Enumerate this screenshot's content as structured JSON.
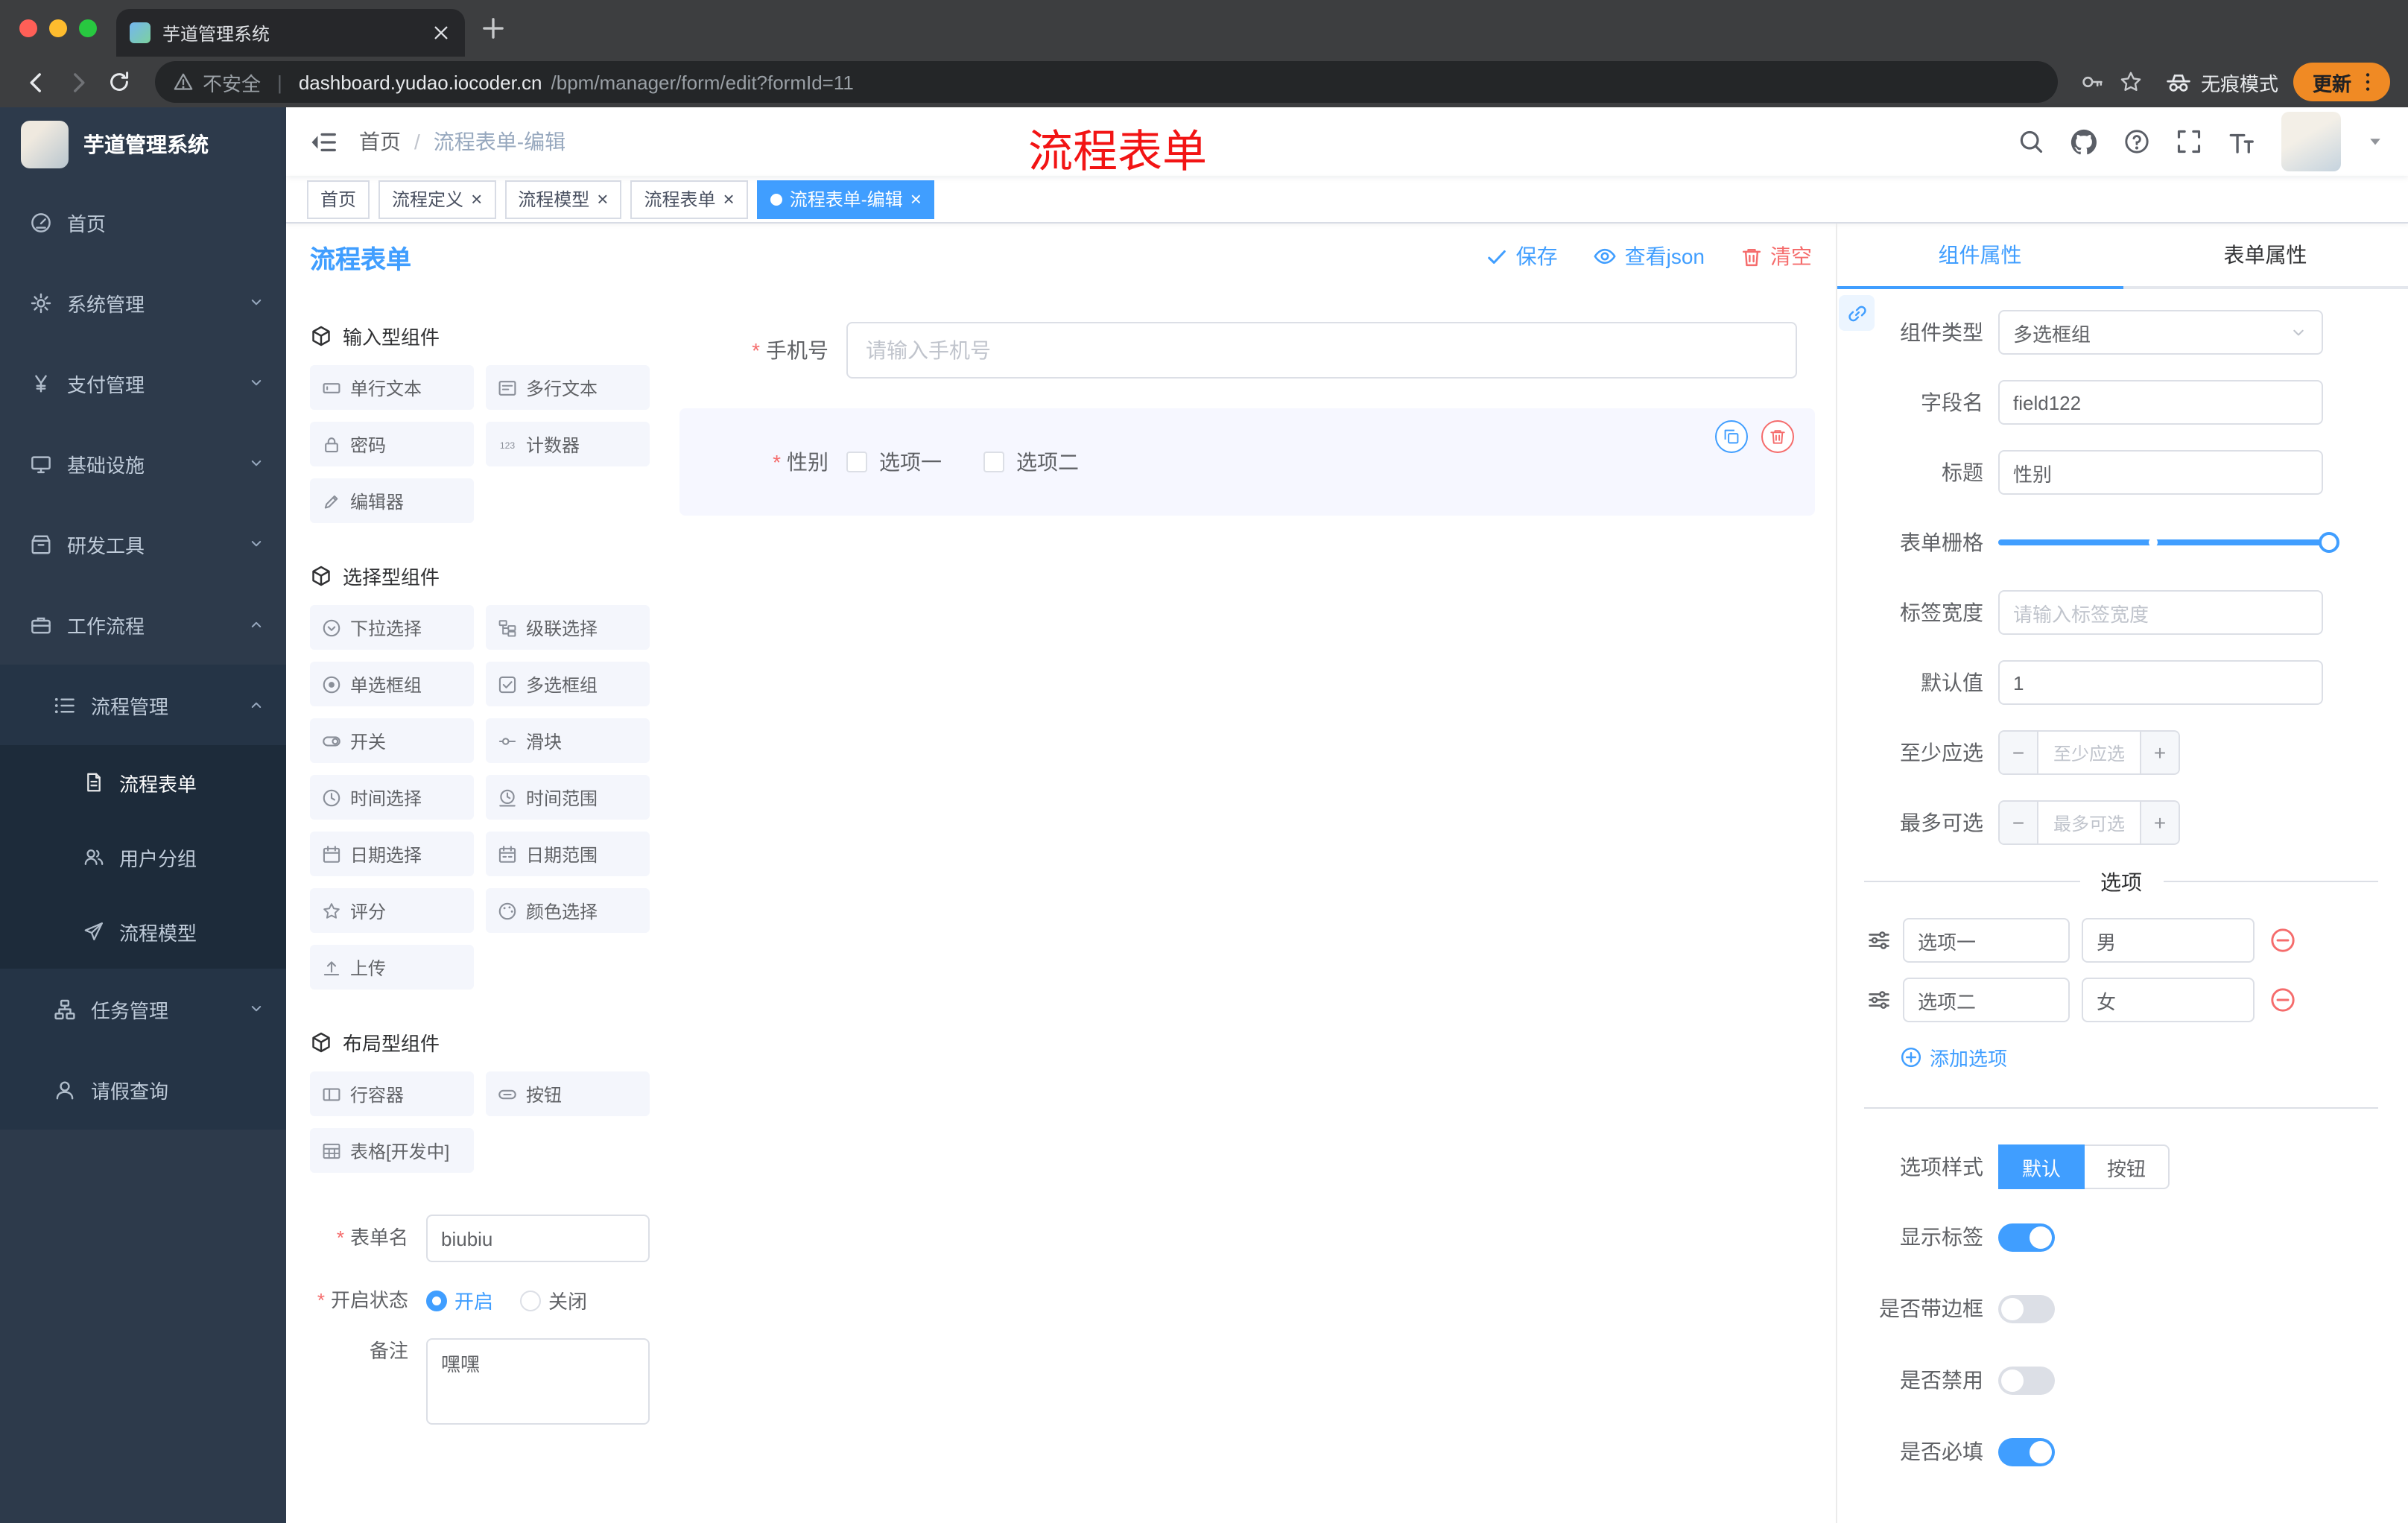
{
  "browser": {
    "tab_title": "芋道管理系统",
    "url_security": "不安全",
    "url_divider": "|",
    "url_domain": "dashboard.yudao.iocoder.cn",
    "url_path": "/bpm/manager/form/edit?formId=11",
    "incognito_label": "无痕模式",
    "update_label": "更新"
  },
  "sidebar": {
    "logo_title": "芋道管理系统",
    "top_items": [
      {
        "label": "首页",
        "icon": "#i-gauge",
        "is_down": false,
        "is_up": false,
        "active": false
      },
      {
        "label": "系统管理",
        "icon": "#i-gear",
        "is_down": true,
        "is_up": false,
        "active": false
      },
      {
        "label": "支付管理",
        "icon": "#i-yen",
        "is_down": true,
        "is_up": false,
        "active": false
      },
      {
        "label": "基础设施",
        "icon": "#i-monitor",
        "is_down": true,
        "is_up": false,
        "active": false
      },
      {
        "label": "研发工具",
        "icon": "#i-box",
        "is_down": true,
        "is_up": false,
        "active": false
      },
      {
        "label": "工作流程",
        "icon": "#i-case",
        "is_down": false,
        "is_up": true,
        "active": false
      }
    ],
    "process_mgmt": {
      "label": "流程管理"
    },
    "process_children": [
      {
        "label": "流程表单",
        "icon": "#i-doc",
        "active": true
      },
      {
        "label": "用户分组",
        "icon": "#i-users",
        "active": false
      },
      {
        "label": "流程模型",
        "icon": "#i-send",
        "active": false
      }
    ],
    "task_mgmt": {
      "label": "任务管理"
    },
    "leave_query": {
      "label": "请假查询"
    }
  },
  "header": {
    "breadcrumb_home": "首页",
    "breadcrumb_sep": "/",
    "breadcrumb_current": "流程表单-编辑",
    "annotation": "流程表单",
    "icons": [
      "search-icon",
      "github-icon",
      "question-icon",
      "fullscreen-icon",
      "font-size-icon",
      "avatar",
      "caret-down-icon"
    ]
  },
  "tags": [
    {
      "label": "首页",
      "closable": false,
      "active": false
    },
    {
      "label": "流程定义",
      "closable": true,
      "active": false
    },
    {
      "label": "流程模型",
      "closable": true,
      "active": false
    },
    {
      "label": "流程表单",
      "closable": true,
      "active": false
    },
    {
      "label": "流程表单-编辑",
      "closable": true,
      "active": true
    }
  ],
  "designer": {
    "title": "流程表单",
    "actions": {
      "save": "保存",
      "view_json": "查看json",
      "clear": "清空"
    },
    "sections": {
      "input_title": "输入型组件",
      "select_title": "选择型组件",
      "layout_title": "布局型组件"
    },
    "input_widgets": [
      {
        "label": "单行文本",
        "icon": "#i-inputbox"
      },
      {
        "label": "多行文本",
        "icon": "#i-textarea"
      },
      {
        "label": "密码",
        "icon": "#i-lock"
      },
      {
        "label": "计数器",
        "icon": "#i-counter"
      },
      {
        "label": "编辑器",
        "icon": "#i-edit"
      }
    ],
    "select_widgets": [
      {
        "label": "下拉选择",
        "icon": "#i-select"
      },
      {
        "label": "级联选择",
        "icon": "#i-cascade"
      },
      {
        "label": "单选框组",
        "icon": "#i-radio"
      },
      {
        "label": "多选框组",
        "icon": "#i-checkbox"
      },
      {
        "label": "开关",
        "icon": "#i-switch"
      },
      {
        "label": "滑块",
        "icon": "#i-slider"
      },
      {
        "label": "时间选择",
        "icon": "#i-time"
      },
      {
        "label": "时间范围",
        "icon": "#i-timerange"
      },
      {
        "label": "日期选择",
        "icon": "#i-date"
      },
      {
        "label": "日期范围",
        "icon": "#i-daterange"
      },
      {
        "label": "评分",
        "icon": "#i-star"
      },
      {
        "label": "颜色选择",
        "icon": "#i-color"
      },
      {
        "label": "上传",
        "icon": "#i-upload"
      }
    ],
    "layout_widgets": [
      {
        "label": "行容器",
        "icon": "#i-rowc"
      },
      {
        "label": "按钮",
        "icon": "#i-btnc"
      },
      {
        "label": "表格[开发中]",
        "icon": "#i-tablec"
      }
    ],
    "form_config": {
      "name_label": "表单名",
      "name_value": "biubiu",
      "status_label": "开启状态",
      "status_on": "开启",
      "status_off": "关闭",
      "remark_label": "备注",
      "remark_value": "嘿嘿"
    }
  },
  "canvas": {
    "phone": {
      "label": "手机号",
      "placeholder": "请输入手机号"
    },
    "gender": {
      "label": "性别",
      "options": [
        "选项一",
        "选项二"
      ]
    }
  },
  "panel": {
    "tabs": [
      "组件属性",
      "表单属性"
    ],
    "rows": {
      "type_label": "组件类型",
      "type_value": "多选框组",
      "field_label": "字段名",
      "field_value": "field122",
      "title_label": "标题",
      "title_value": "性别",
      "grid_label": "表单栅格",
      "label_width_label": "标签宽度",
      "label_width_placeholder": "请输入标签宽度",
      "default_label": "默认值",
      "default_value": "1",
      "min_label": "至少应选",
      "min_placeholder": "至少应选",
      "max_label": "最多可选",
      "max_placeholder": "最多可选"
    },
    "options": {
      "divider": "选项",
      "items": [
        {
          "label": "选项一",
          "value": "男"
        },
        {
          "label": "选项二",
          "value": "女"
        }
      ],
      "add_label": "添加选项"
    },
    "style": {
      "label": "选项样式",
      "choices": [
        {
          "label": "默认",
          "active": true
        },
        {
          "label": "按钮",
          "active": false
        }
      ]
    },
    "switches": [
      {
        "label": "显示标签",
        "on": true
      },
      {
        "label": "是否带边框",
        "on": false
      },
      {
        "label": "是否禁用",
        "on": false
      },
      {
        "label": "是否必填",
        "on": true
      }
    ]
  },
  "colors": {
    "accent": "#409EFF",
    "danger": "#F56C6C",
    "sidebar_bg": "#2D3A4B",
    "active_tag": "#409EFF",
    "annotation_red": "#F21414",
    "update_pill": "#F08A24",
    "selected_widget_bg": "#F6F7FF"
  }
}
